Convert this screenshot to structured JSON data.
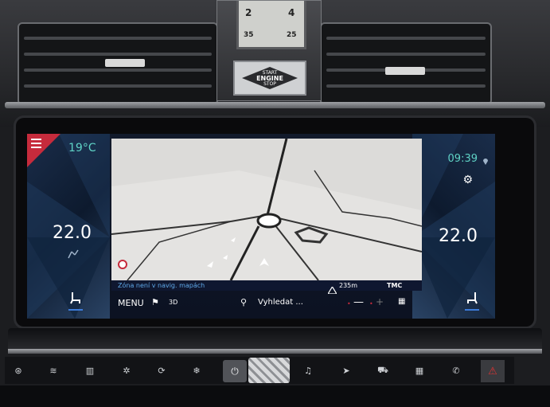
{
  "climate": {
    "exterior_temp": "19°C",
    "driver_temp": "22.0",
    "passenger_temp": "22.0"
  },
  "clock": {
    "time": "09:39",
    "analog_labels": [
      "2",
      "4",
      "35",
      "25"
    ]
  },
  "engine_button": {
    "line1": "START",
    "line2": "ENGINE",
    "line3": "STOP"
  },
  "navigation": {
    "zone_message": "Zóna není v navig. mapách",
    "scale": "235m",
    "traffic_label": "TMC",
    "menu_label": "MENU",
    "view_mode": "3D",
    "search_label": "Vyhledat ...",
    "zoom_out": "—",
    "zoom_in": "+"
  },
  "icons": {
    "menu": "hamburger-icon",
    "location": "location-pin-icon",
    "settings": "gear-icon",
    "airflow": "airflow-icon",
    "seat_heat": "seat-heat-icon",
    "flag": "checkered-flag-icon",
    "search": "search-icon",
    "power": "power-icon",
    "hazard": "hazard-icon"
  },
  "colors": {
    "accent_teal": "#5fd3c6",
    "menu_red": "#c62b3c",
    "zone_text_blue": "#5fa8e8"
  },
  "console_buttons": [
    {
      "name": "front-defrost",
      "glyph": "⊛"
    },
    {
      "name": "windshield-heat",
      "glyph": "≋"
    },
    {
      "name": "rear-defrost",
      "glyph": "▥"
    },
    {
      "name": "fan",
      "glyph": "✲"
    },
    {
      "name": "recirculation",
      "glyph": "⟳"
    },
    {
      "name": "a-c",
      "glyph": "❄"
    },
    {
      "name": "media",
      "glyph": "♫"
    },
    {
      "name": "navigation",
      "glyph": "➤"
    },
    {
      "name": "car",
      "glyph": "⛟"
    },
    {
      "name": "apps",
      "glyph": "▦"
    },
    {
      "name": "phone",
      "glyph": "✆"
    }
  ]
}
